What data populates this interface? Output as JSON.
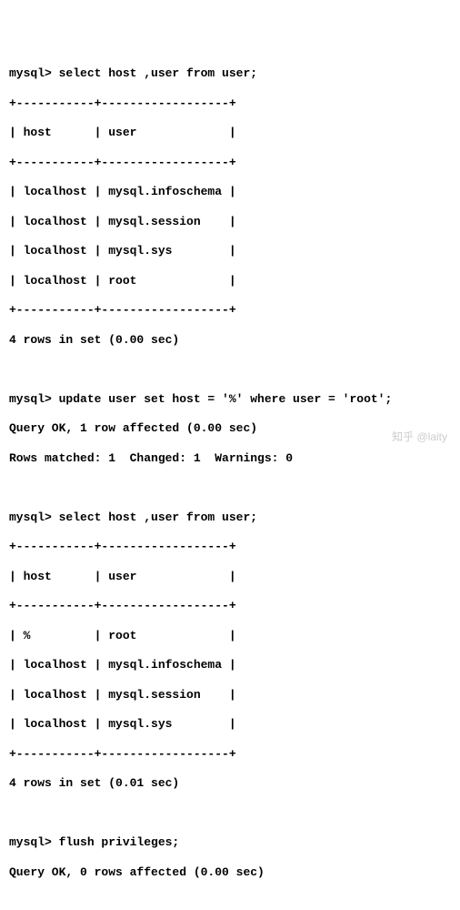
{
  "query1": {
    "prompt": "mysql> ",
    "sql": "select host ,user from user;",
    "border": "+-----------+------------------+",
    "header": "| host      | user             |",
    "rows": [
      "| localhost | mysql.infoschema |",
      "| localhost | mysql.session    |",
      "| localhost | mysql.sys        |",
      "| localhost | root             |"
    ],
    "footer": "4 rows in set (0.00 sec)"
  },
  "update": {
    "prompt": "mysql> ",
    "sql": "update user set host = '%' where user = 'root';",
    "result1": "Query OK, 1 row affected (0.00 sec)",
    "result2": "Rows matched: 1  Changed: 1  Warnings: 0"
  },
  "query2": {
    "prompt": "mysql> ",
    "sql": "select host ,user from user;",
    "border": "+-----------+------------------+",
    "header": "| host      | user             |",
    "rows": [
      "| %         | root             |",
      "| localhost | mysql.infoschema |",
      "| localhost | mysql.session    |",
      "| localhost | mysql.sys        |"
    ],
    "footer": "4 rows in set (0.01 sec)"
  },
  "flush": {
    "prompt": "mysql> ",
    "sql": "flush privileges;",
    "result": "Query OK, 0 rows affected (0.00 sec)"
  },
  "watermark": "知乎 @laity"
}
